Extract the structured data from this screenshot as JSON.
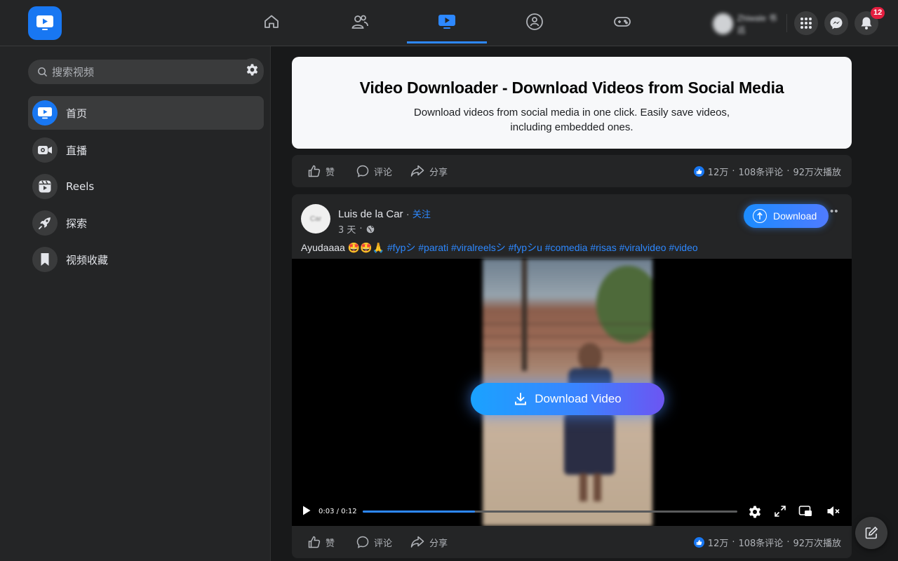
{
  "header": {
    "nav_tabs": [
      {
        "name": "home",
        "icon": "home-icon"
      },
      {
        "name": "friends",
        "icon": "friends-icon"
      },
      {
        "name": "watch",
        "icon": "video-icon",
        "active": true
      },
      {
        "name": "groups",
        "icon": "groups-icon"
      },
      {
        "name": "gaming",
        "icon": "gamepad-icon"
      }
    ],
    "profile_name": "Zhiwale 书远",
    "notification_count": "12",
    "accent_color": "#2d88ff"
  },
  "sidebar": {
    "search_placeholder": "搜索视频",
    "items": [
      {
        "label": "首页",
        "icon": "video-play-icon",
        "active": true
      },
      {
        "label": "直播",
        "icon": "live-camera-icon"
      },
      {
        "label": "Reels",
        "icon": "reels-icon"
      },
      {
        "label": "探索",
        "icon": "rocket-icon"
      },
      {
        "label": "视频收藏",
        "icon": "bookmark-icon"
      }
    ]
  },
  "banner": {
    "title": "Video Downloader - Download Videos from Social Media",
    "description": "Download videos from social media in one click. Easily save videos, including embedded ones."
  },
  "action_bar": {
    "like": "赞",
    "comment": "评论",
    "share": "分享",
    "likes_count": "12万",
    "comments_count": "108条评论",
    "views_count": "92万次播放"
  },
  "post": {
    "author": "Luis de la Car",
    "follow": "关注",
    "time": "3 天",
    "avatar_text": "Car",
    "download_label": "Download",
    "caption_text": "Ayudaaaa 🤩🤩🙏",
    "hashtags": "#fypシ #parati #viralreelsシ #fypシu #comedia #risas #viralvideo #video",
    "download_video_label": "Download Video",
    "video_time": "0:03 / 0:12",
    "progress": 0.3
  }
}
